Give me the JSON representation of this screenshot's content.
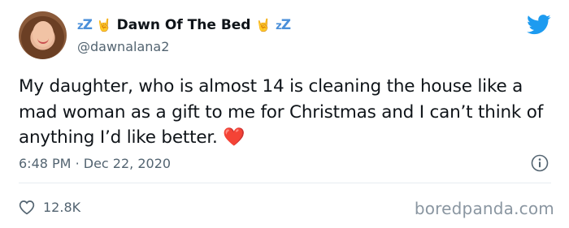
{
  "author": {
    "name": "Dawn Of The Bed",
    "name_prefix_emoji": "zzZ 🤘",
    "name_suffix_emoji": "🤘 zzZ",
    "handle": "@dawnalana2"
  },
  "tweet": {
    "text": "My daughter, who is almost 14 is cleaning the house like a mad woman as a gift to me for Christmas and I can’t think of anything I’d like better.",
    "emoji": "❤️",
    "time": "6:48 PM",
    "separator": "·",
    "date": "Dec 22, 2020",
    "like_count": "12.8K"
  },
  "icons": {
    "brand": "twitter-bird-icon",
    "info": "info-icon",
    "like": "heart-outline-icon"
  },
  "colors": {
    "brand_blue": "#1d9bf0",
    "text": "#0f1419",
    "secondary": "#536471",
    "heart": "#e0245e"
  },
  "watermark": "boredpanda.com"
}
